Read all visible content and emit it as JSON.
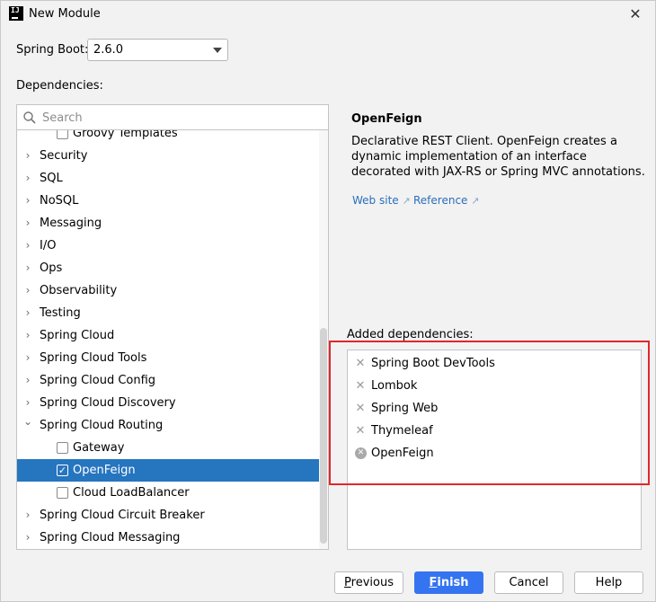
{
  "window": {
    "title": "New Module",
    "close_glyph": "✕"
  },
  "spring_boot": {
    "label": "Spring Boot:",
    "version": "2.6.0"
  },
  "dependencies": {
    "label": "Dependencies:",
    "search_placeholder": "Search",
    "tree": [
      {
        "label": "Groovy Templates",
        "kind": "child",
        "checked": false
      },
      {
        "label": "Security",
        "kind": "group",
        "expanded": false
      },
      {
        "label": "SQL",
        "kind": "group",
        "expanded": false
      },
      {
        "label": "NoSQL",
        "kind": "group",
        "expanded": false
      },
      {
        "label": "Messaging",
        "kind": "group",
        "expanded": false
      },
      {
        "label": "I/O",
        "kind": "group",
        "expanded": false
      },
      {
        "label": "Ops",
        "kind": "group",
        "expanded": false
      },
      {
        "label": "Observability",
        "kind": "group",
        "expanded": false
      },
      {
        "label": "Testing",
        "kind": "group",
        "expanded": false
      },
      {
        "label": "Spring Cloud",
        "kind": "group",
        "expanded": false
      },
      {
        "label": "Spring Cloud Tools",
        "kind": "group",
        "expanded": false
      },
      {
        "label": "Spring Cloud Config",
        "kind": "group",
        "expanded": false
      },
      {
        "label": "Spring Cloud Discovery",
        "kind": "group",
        "expanded": false
      },
      {
        "label": "Spring Cloud Routing",
        "kind": "group",
        "expanded": true
      },
      {
        "label": "Gateway",
        "kind": "child",
        "checked": false
      },
      {
        "label": "OpenFeign",
        "kind": "child",
        "checked": true,
        "selected": true
      },
      {
        "label": "Cloud LoadBalancer",
        "kind": "child",
        "checked": false
      },
      {
        "label": "Spring Cloud Circuit Breaker",
        "kind": "group",
        "expanded": false
      },
      {
        "label": "Spring Cloud Messaging",
        "kind": "group",
        "expanded": false
      }
    ]
  },
  "details": {
    "title": "OpenFeign",
    "description": "Declarative REST Client. OpenFeign creates a dynamic implementation of an interface decorated with JAX-RS or Spring MVC annotations.",
    "website_link": "Web site",
    "reference_link": "Reference",
    "link_arrow": "↗"
  },
  "added": {
    "label": "Added dependencies:",
    "items": [
      {
        "label": "Spring Boot DevTools",
        "remove_style": "x"
      },
      {
        "label": "Lombok",
        "remove_style": "x"
      },
      {
        "label": "Spring Web",
        "remove_style": "x"
      },
      {
        "label": "Thymeleaf",
        "remove_style": "x"
      },
      {
        "label": "OpenFeign",
        "remove_style": "circle"
      }
    ]
  },
  "buttons": {
    "previous": {
      "mnemonic": "P",
      "rest": "revious"
    },
    "finish": {
      "mnemonic": "F",
      "rest": "inish"
    },
    "cancel": "Cancel",
    "help": "Help"
  },
  "colors": {
    "selection": "#2675bf",
    "primary_button": "#3574f0",
    "highlight_box": "#e3262c",
    "link": "#2a6ebb"
  },
  "icons": {
    "app": "intellij-icon",
    "search": "search-icon",
    "collapsed": "chevron-right-icon",
    "expanded": "chevron-down-icon",
    "check": "check-icon",
    "remove": "close-icon"
  }
}
